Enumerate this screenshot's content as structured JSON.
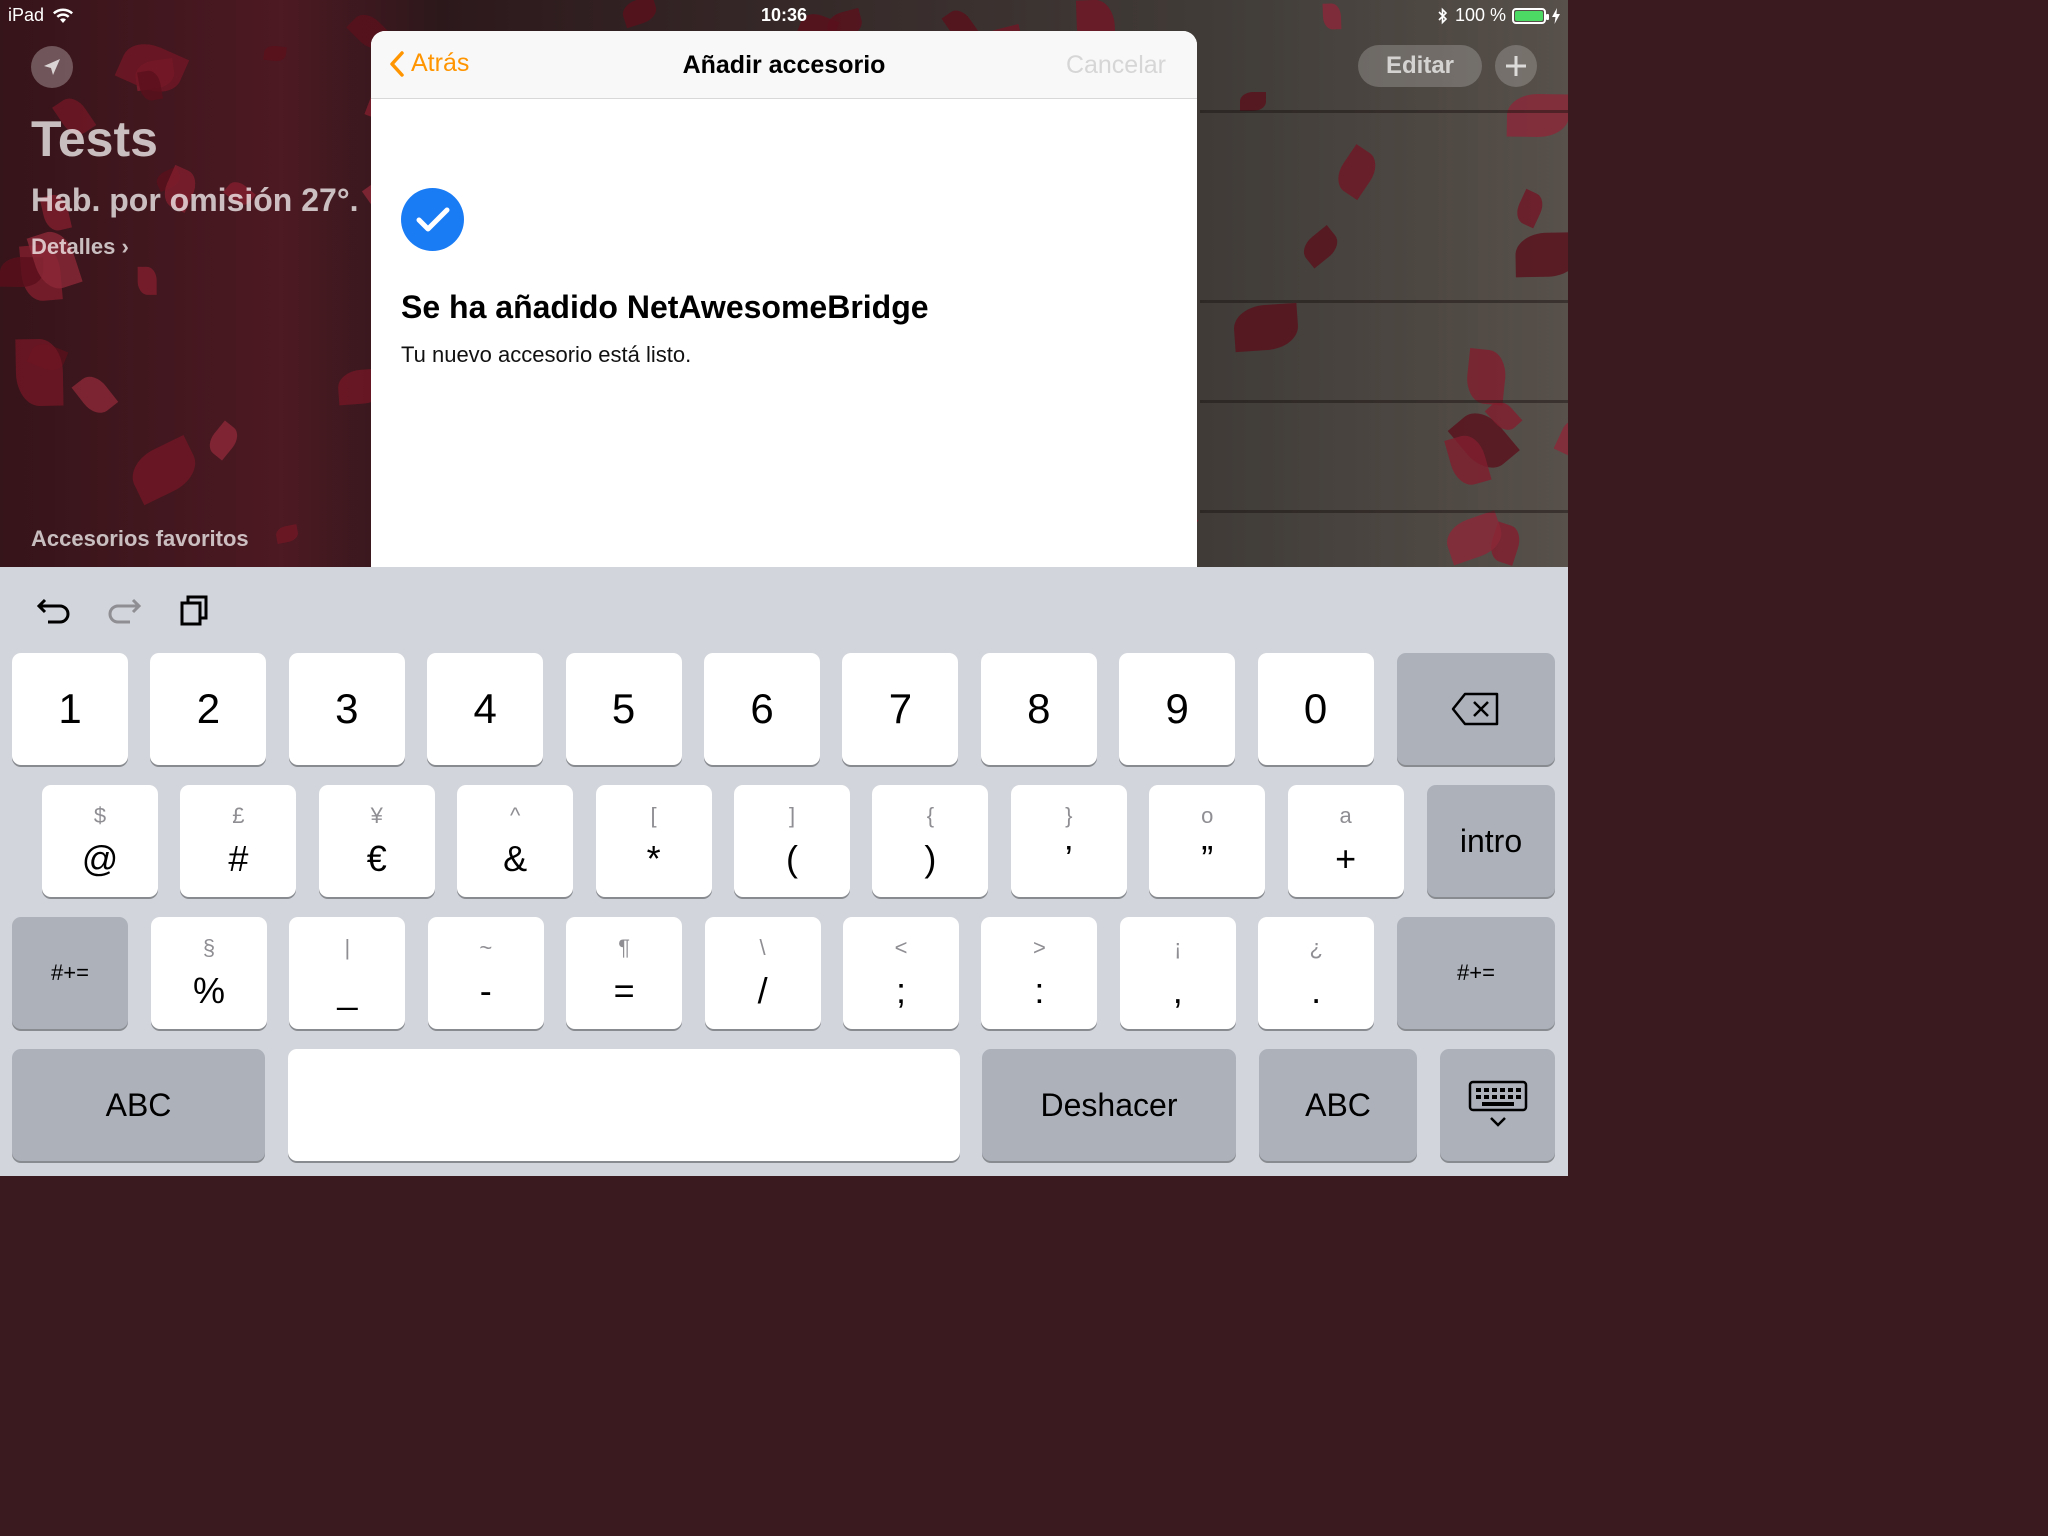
{
  "status_bar": {
    "device": "iPad",
    "time": "10:36",
    "battery": "100 %",
    "battery_level": 1.0,
    "battery_color": "#4cd964"
  },
  "home": {
    "title": "Tests",
    "subtitle": "Hab. por omisión 27°.",
    "details": "Detalles ›",
    "favorites": "Accesorios favoritos",
    "edit_label": "Editar"
  },
  "modal": {
    "back_label": "Atrás",
    "title": "Añadir accesorio",
    "cancel_label": "Cancelar",
    "success_title": "Se ha añadido NetAwesomeBridge",
    "success_desc": "Tu nuevo accesorio está listo.",
    "accent_color": "#ff9500",
    "check_color": "#1a7cf5"
  },
  "keyboard": {
    "toolbar": [
      "undo-icon",
      "redo-icon",
      "paste-icon"
    ],
    "row1": [
      "1",
      "2",
      "3",
      "4",
      "5",
      "6",
      "7",
      "8",
      "9",
      "0"
    ],
    "row2": [
      {
        "alt": "$",
        "main": "@"
      },
      {
        "alt": "£",
        "main": "#"
      },
      {
        "alt": "¥",
        "main": "€"
      },
      {
        "alt": "^",
        "main": "&"
      },
      {
        "alt": "[",
        "main": "*"
      },
      {
        "alt": "]",
        "main": "("
      },
      {
        "alt": "{",
        "main": ")"
      },
      {
        "alt": "}",
        "main": "’"
      },
      {
        "alt": "o",
        "main": "”"
      },
      {
        "alt": "a",
        "main": "+"
      }
    ],
    "return_label": "intro",
    "row3": [
      {
        "alt": "§",
        "main": "%"
      },
      {
        "alt": "|",
        "main": "_"
      },
      {
        "alt": "~",
        "main": "-"
      },
      {
        "alt": "¶",
        "main": "="
      },
      {
        "alt": "\\",
        "main": "/"
      },
      {
        "alt": "<",
        "main": ";"
      },
      {
        "alt": ">",
        "main": ":"
      },
      {
        "alt": "¡",
        "main": ","
      },
      {
        "alt": "¿",
        "main": "."
      }
    ],
    "shift_label": "#+=",
    "abc_label": "ABC",
    "undo_label": "Deshacer"
  }
}
